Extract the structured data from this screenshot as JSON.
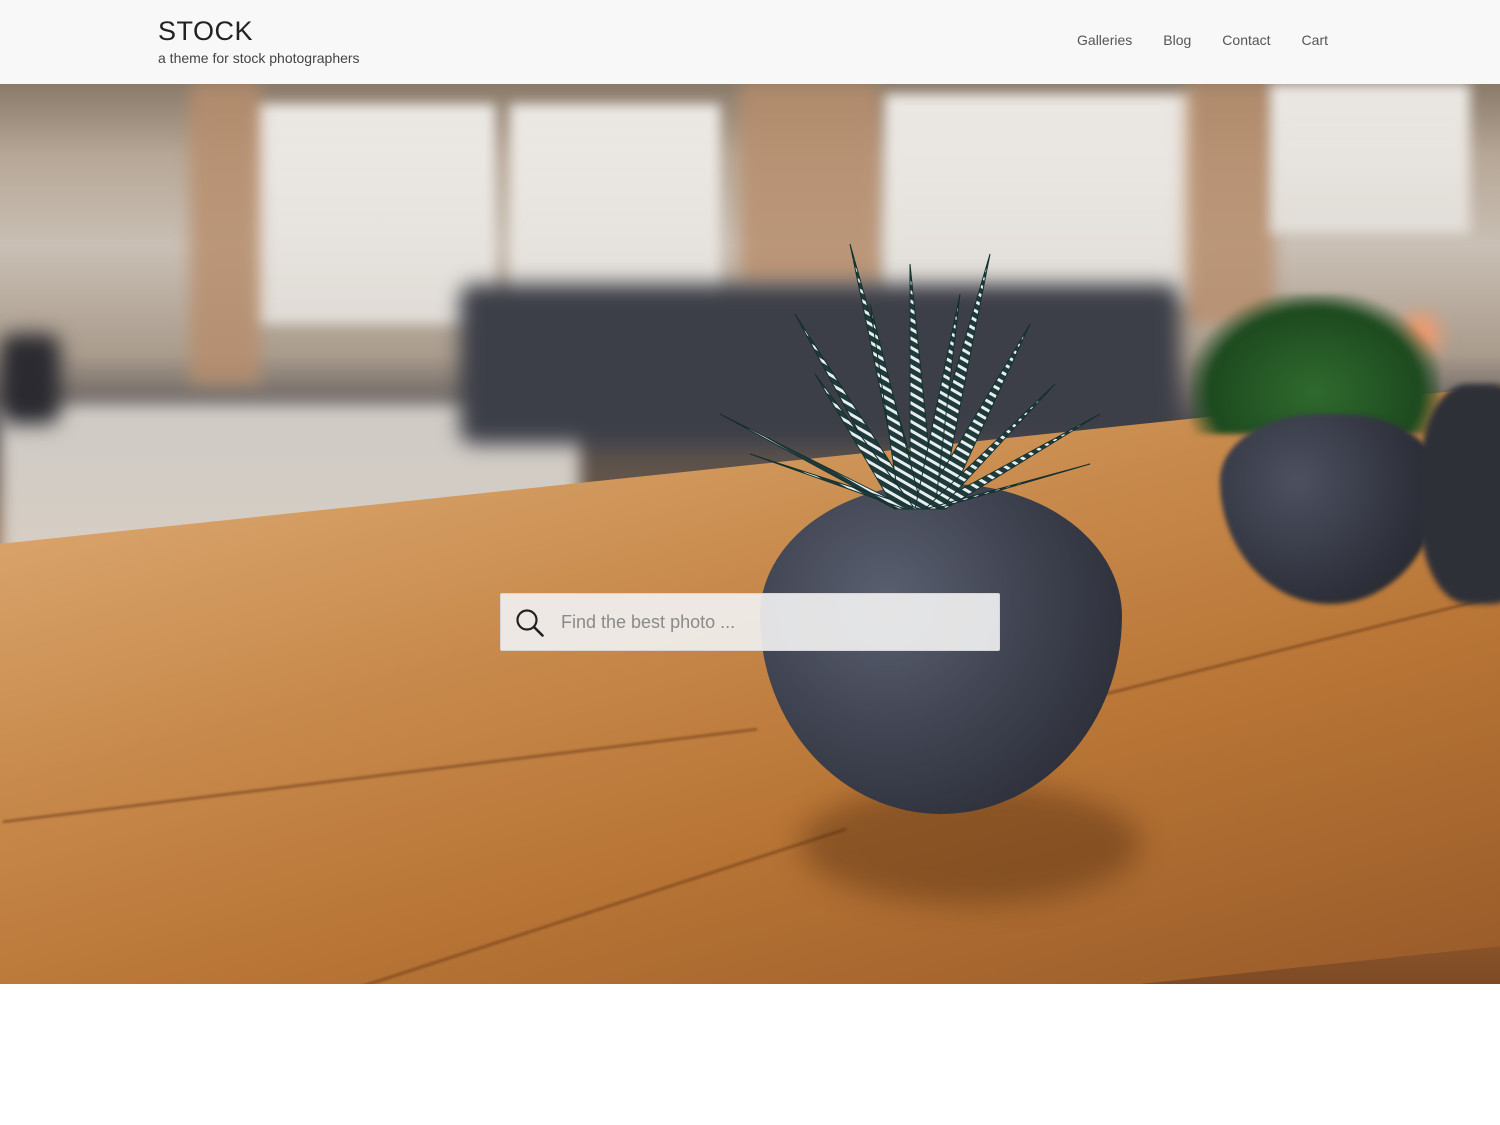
{
  "site": {
    "title": "STOCK",
    "tagline": "a theme for stock photographers"
  },
  "nav": {
    "items": [
      {
        "label": "Galleries"
      },
      {
        "label": "Blog"
      },
      {
        "label": "Contact"
      },
      {
        "label": "Cart"
      }
    ]
  },
  "hero": {
    "search": {
      "placeholder": "Find the best photo ...",
      "value": "",
      "icon": "search-icon"
    }
  },
  "colors": {
    "header_bg": "#f8f8f8",
    "text_dark": "#222222",
    "nav_text": "#555555",
    "search_bg": "#f0f0f0"
  }
}
